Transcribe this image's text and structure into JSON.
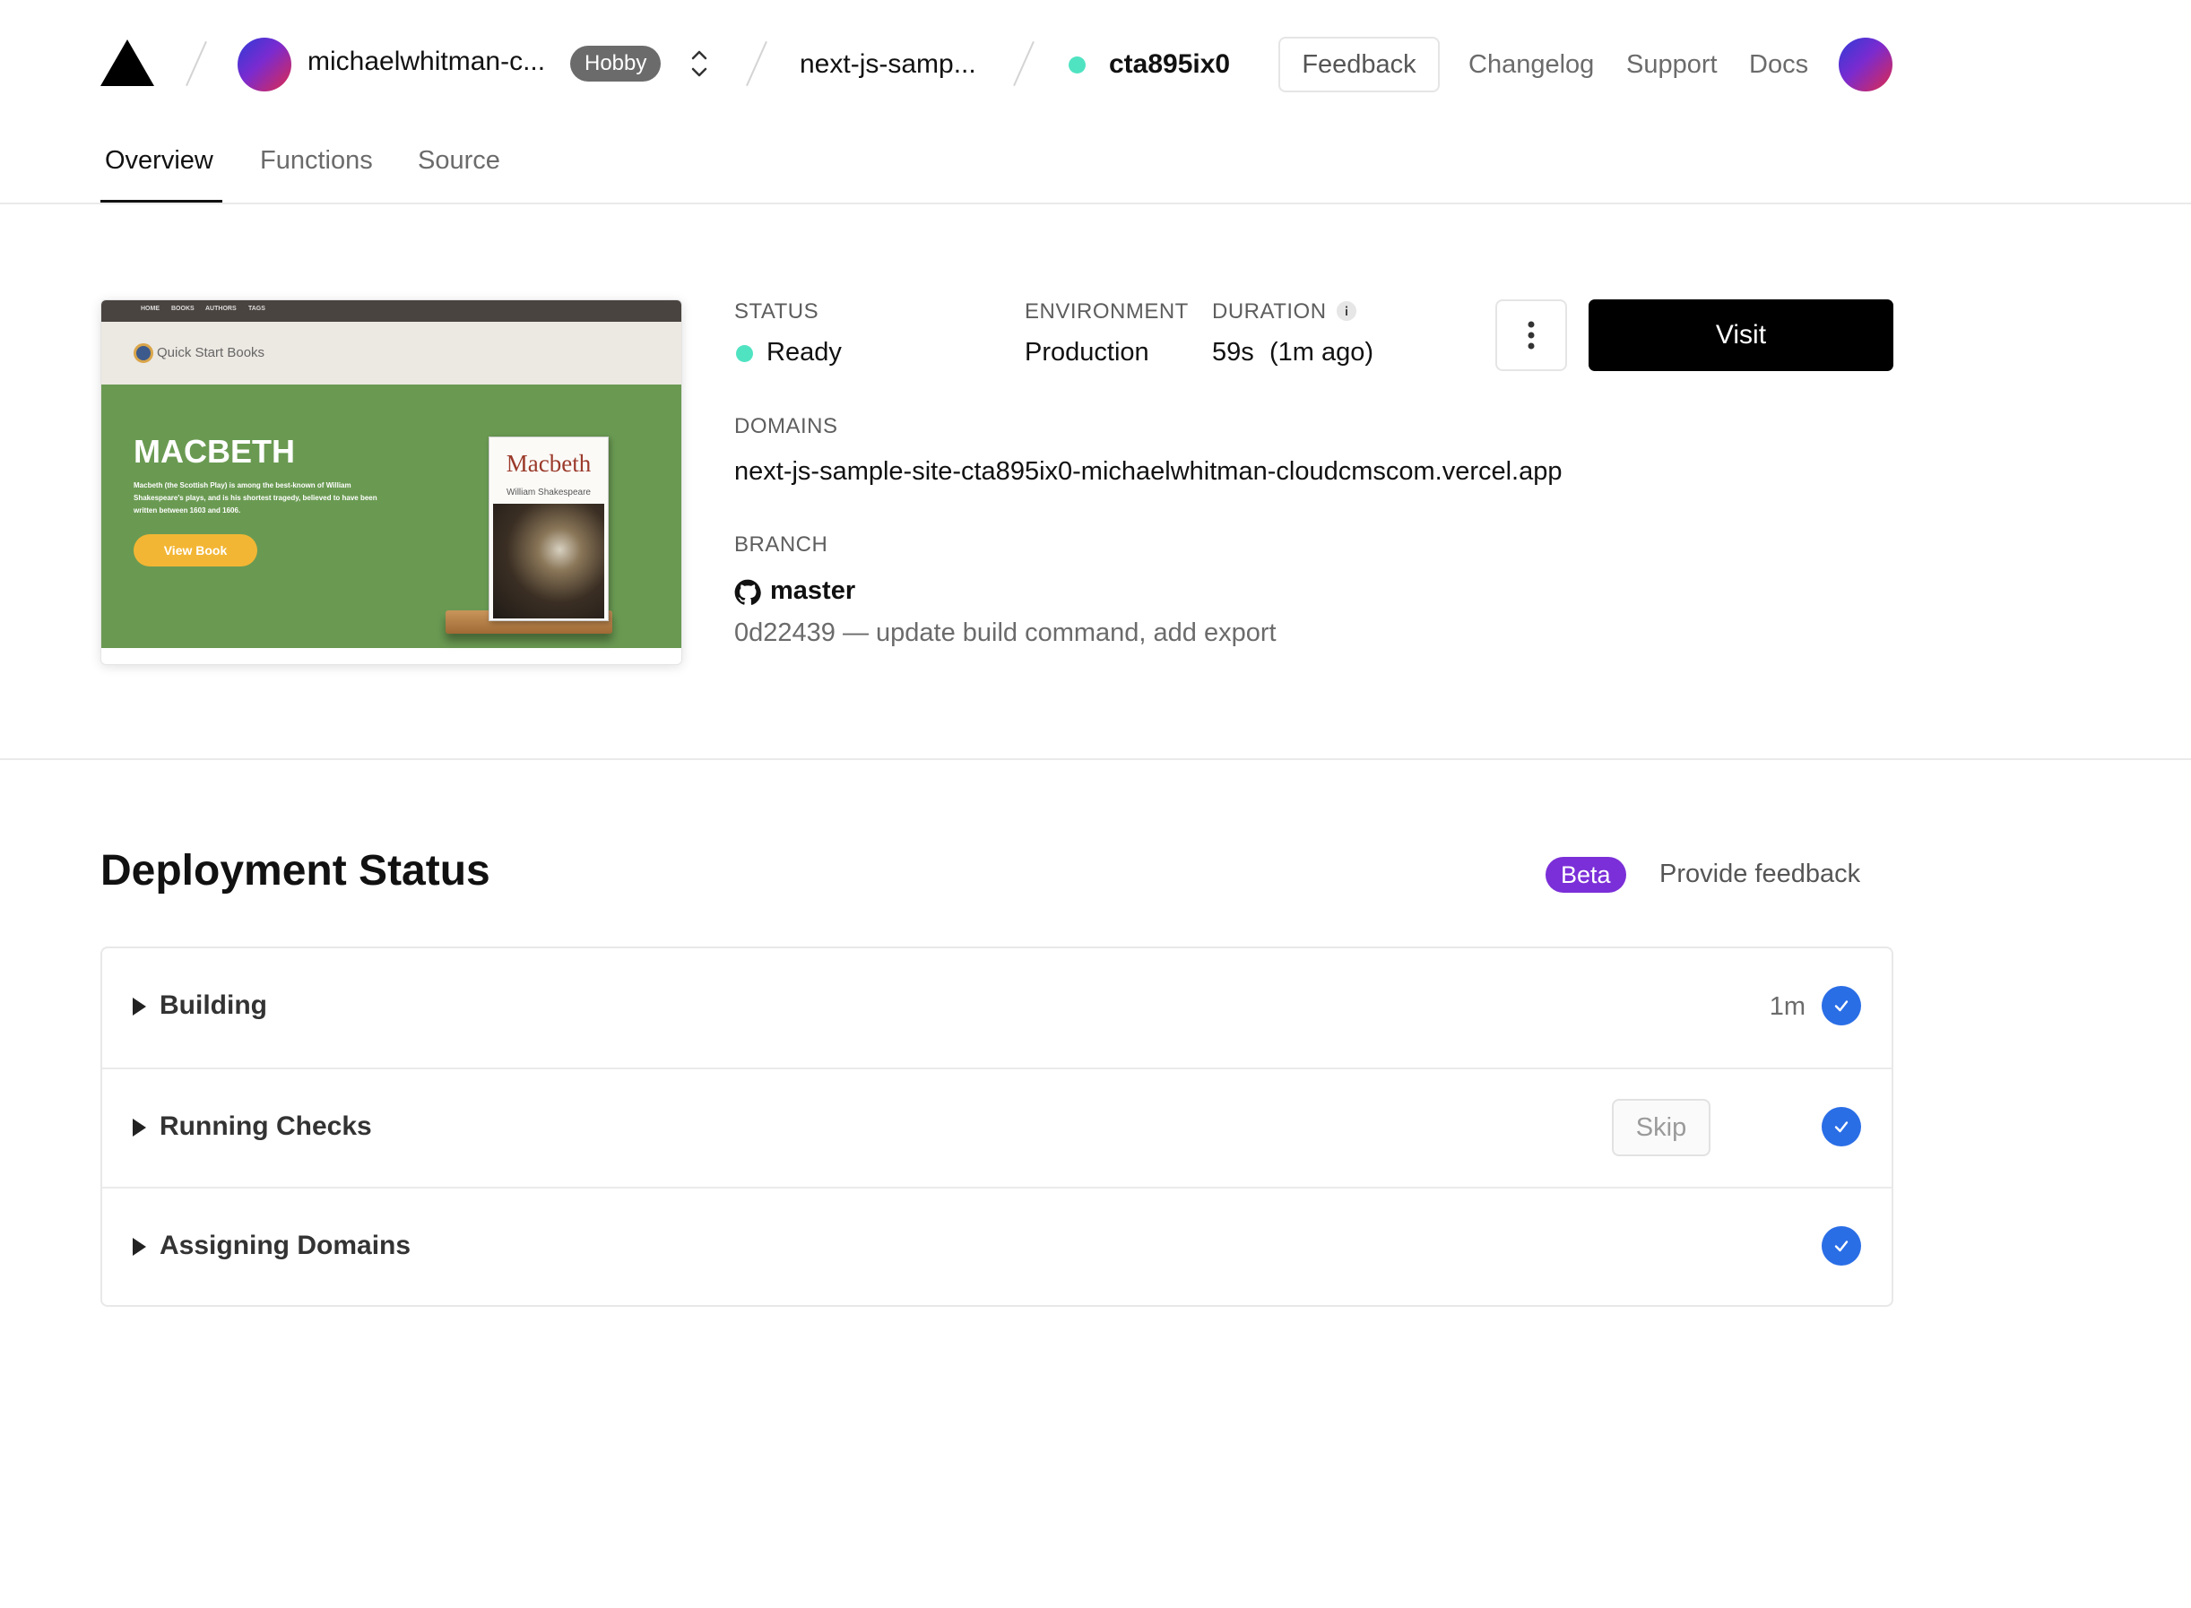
{
  "header": {
    "team": "michaelwhitman-c...",
    "plan_badge": "Hobby",
    "project": "next-js-samp...",
    "deployment_id": "cta895ix0",
    "feedback_label": "Feedback",
    "links": [
      "Changelog",
      "Support",
      "Docs"
    ],
    "icons": {
      "logo": "vercel-triangle-icon",
      "switcher": "chevron-up-down-icon",
      "avatar": "user-avatar-gradient"
    }
  },
  "tabs": [
    {
      "label": "Overview",
      "active": true
    },
    {
      "label": "Functions",
      "active": false
    },
    {
      "label": "Source",
      "active": false
    }
  ],
  "preview": {
    "nav_items": [
      "HOME",
      "BOOKS",
      "AUTHORS",
      "TAGS"
    ],
    "brand": "Quick Start Books",
    "hero_title": "MACBETH",
    "hero_description": "Macbeth (the Scottish Play) is among the best-known of William Shakespeare's plays, and is his shortest tragedy, believed to have been written between 1603 and 1606.",
    "hero_button": "View Book",
    "book_title": "Macbeth",
    "book_author": "William Shakespeare"
  },
  "deployment": {
    "status_label": "STATUS",
    "status_value": "Ready",
    "environment_label": "ENVIRONMENT",
    "environment_value": "Production",
    "duration_label": "DURATION",
    "duration_value": "59s",
    "duration_ago": "(1m ago)",
    "domains_label": "DOMAINS",
    "domain": "next-js-sample-site-cta895ix0-michaelwhitman-cloudcmscom.vercel.app",
    "branch_label": "BRANCH",
    "branch": "master",
    "commit": "0d22439 — update build command, add export",
    "visit_label": "Visit"
  },
  "status_section": {
    "title": "Deployment Status",
    "beta_badge": "Beta",
    "provide_feedback": "Provide feedback",
    "steps": [
      {
        "label": "Building",
        "time": "1m",
        "done": true
      },
      {
        "label": "Running Checks",
        "action": "Skip",
        "done": true
      },
      {
        "label": "Assigning Domains",
        "done": true
      }
    ]
  },
  "colors": {
    "ready": "#50e3c2",
    "beta": "#7b2fd8",
    "check": "#2a6ee6",
    "primary_button": "#000000"
  }
}
